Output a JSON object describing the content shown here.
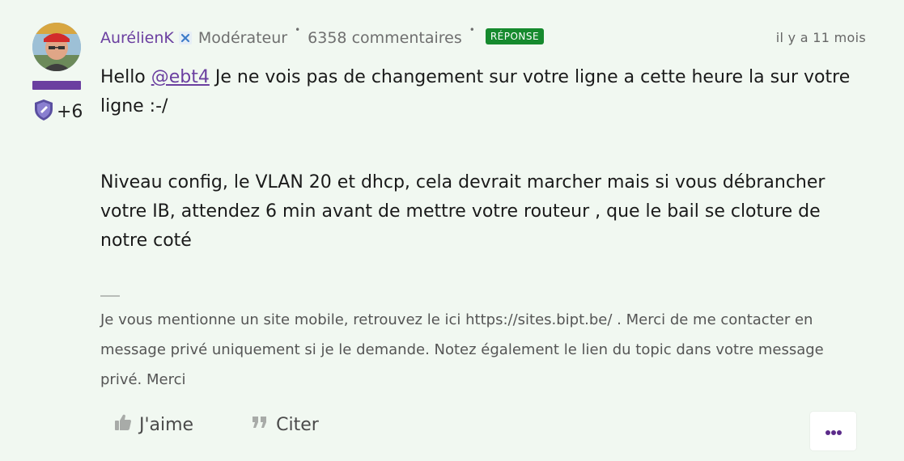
{
  "post": {
    "author": {
      "name": "AurélienK",
      "role": "Modérateur",
      "comment_count": "6358 commentaires",
      "badge_count": "+6",
      "rank_color": "#6b3fa0",
      "icons": [
        "moderator-icon",
        "shield-badge-icon",
        "avatar"
      ]
    },
    "answer_label": "RÉPONSE",
    "answer_color": "#168a2e",
    "separator": "•",
    "timestamp": "il y a 11 mois",
    "body": {
      "greeting": "Hello ",
      "mention": "@ebt4",
      "paragraph1_rest": " Je ne vois pas de changement sur votre ligne a cette heure la sur votre ligne :-/",
      "paragraph2": "Niveau config, le VLAN 20 et dhcp, cela devrait marcher mais si vous débrancher votre IB, attendez 6 min avant de mettre votre routeur , que le bail se cloture de notre coté"
    },
    "signature": "Je vous mentionne un site mobile, retrouvez le ici https://sites.bipt.be/ . Merci de me contacter en message privé uniquement si je le demande. Notez également le lien du topic dans votre message privé. Merci",
    "actions": {
      "like_label": "J'aime",
      "quote_label": "Citer",
      "more_icon": "more-dots-icon"
    }
  }
}
